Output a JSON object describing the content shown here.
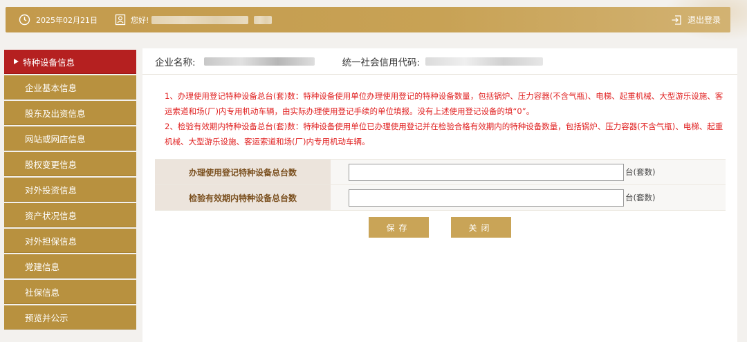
{
  "header": {
    "date": "2025年02月21日",
    "greeting": "您好!",
    "logout_label": "退出登录"
  },
  "sidebar": {
    "items": [
      {
        "label": "特种设备信息",
        "active": true
      },
      {
        "label": "企业基本信息"
      },
      {
        "label": "股东及出资信息"
      },
      {
        "label": "网站或网店信息"
      },
      {
        "label": "股权变更信息"
      },
      {
        "label": "对外投资信息"
      },
      {
        "label": "资产状况信息"
      },
      {
        "label": "对外担保信息"
      },
      {
        "label": "党建信息"
      },
      {
        "label": "社保信息"
      },
      {
        "label": "预览并公示"
      }
    ]
  },
  "main": {
    "company_label": "企业名称:",
    "credit_code_label": "统一社会信用代码:",
    "notice_1": "1、办理使用登记特种设备总台(套)数：特种设备使用单位办理使用登记的特种设备数量，包括锅炉、压力容器(不含气瓶)、电梯、起重机械、大型游乐设施、客运索道和场(厂)内专用机动车辆，由实际办理使用登记手续的单位填报。没有上述使用登记设备的填“0”。",
    "notice_2": "2、检验有效期内特种设备总台(套)数：特种设备使用单位已办理使用登记并在检验合格有效期内的特种设备数量，包括锅炉、压力容器(不含气瓶)、电梯、起重机械、大型游乐设施、客运索道和场(厂)内专用机动车辆。",
    "form": [
      {
        "label": "办理使用登记特种设备总台数",
        "value": "",
        "unit": "台(套数)"
      },
      {
        "label": "检验有效期内特种设备总台数",
        "value": "",
        "unit": "台(套数)"
      }
    ],
    "save_label": "保存",
    "close_label": "关闭"
  },
  "colors": {
    "gold": "#c39a4c",
    "sidebar_gold": "#b8913f",
    "active_red": "#b52020",
    "notice_red": "#e02020"
  }
}
